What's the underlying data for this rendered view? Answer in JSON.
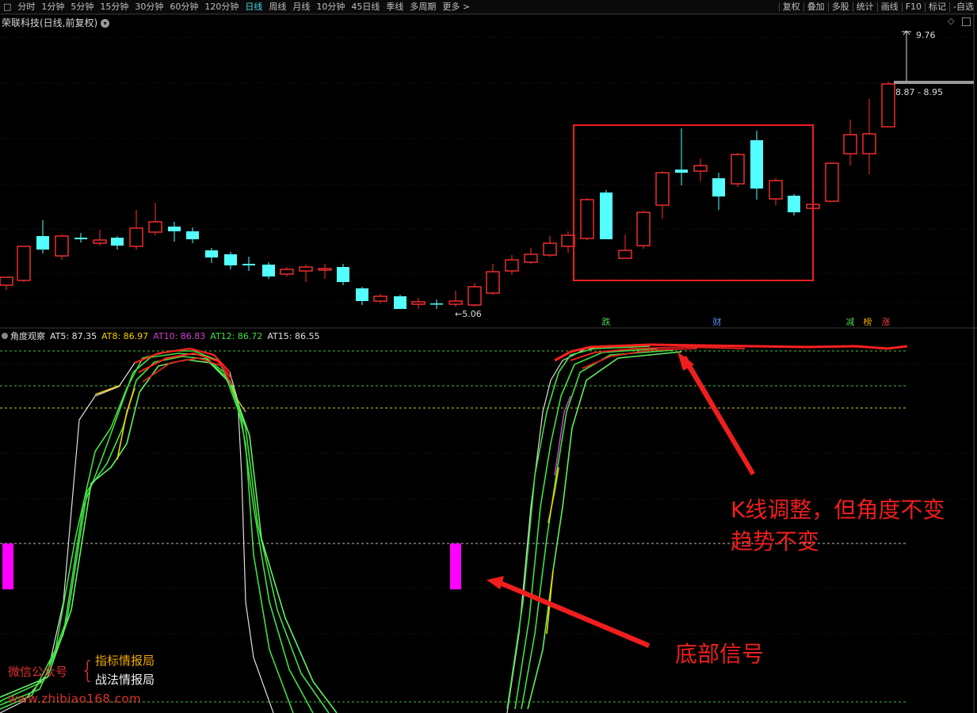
{
  "toolbar": {
    "left_tabs": [
      "分时",
      "1分钟",
      "5分钟",
      "15分钟",
      "30分钟",
      "60分钟",
      "120分钟",
      "日线",
      "周线",
      "月线",
      "10分钟",
      "45日线",
      "季线",
      "多周期",
      "更多 >"
    ],
    "active_tab": "日线",
    "right_tabs": [
      "复权",
      "叠加",
      "多股",
      "统计",
      "画线",
      "F10",
      "标记",
      "-自选"
    ]
  },
  "chart": {
    "title": "荣联科技(日线,前复权)",
    "high_label": "9.76",
    "price_range": "8.87 - 8.95",
    "low_label": "5.06",
    "low_arrow": "←",
    "event_tags": [
      {
        "text": "跌",
        "color": "#4ed24e"
      },
      {
        "text": "财",
        "color": "#5d8ef2"
      },
      {
        "text": "减",
        "color": "#4ed24e"
      },
      {
        "text": "榜",
        "color": "#f0a800"
      },
      {
        "text": "涨",
        "color": "#e84040"
      }
    ]
  },
  "indicator": {
    "name": "角度观察",
    "values": [
      {
        "label": "AT5: 87.35",
        "color": "#e8e8e8"
      },
      {
        "label": "AT8: 86.97",
        "color": "#f5d100"
      },
      {
        "label": "AT10: 86.83",
        "color": "#d040d0"
      },
      {
        "label": "AT12: 86.72",
        "color": "#40e040"
      },
      {
        "label": "AT15: 86.55",
        "color": "#e0e0e0"
      }
    ]
  },
  "annotations": {
    "kline_note_line1": "K线调整，但角度不变",
    "kline_note_line2": "趋势不变",
    "bottom_signal": "底部信号"
  },
  "watermark": {
    "wechat": "微信公众号",
    "brace": "{",
    "name1": "指标情报局",
    "name2": "战法情报局",
    "url": "www.zhibiao168.com"
  },
  "colors": {
    "up": "#ff3030",
    "down": "#54ffff",
    "annotation": "#f01e1e",
    "grid_green": "#3fbf3f",
    "grid_yellow": "#d8c04a",
    "signal": "#ff00ff"
  }
}
